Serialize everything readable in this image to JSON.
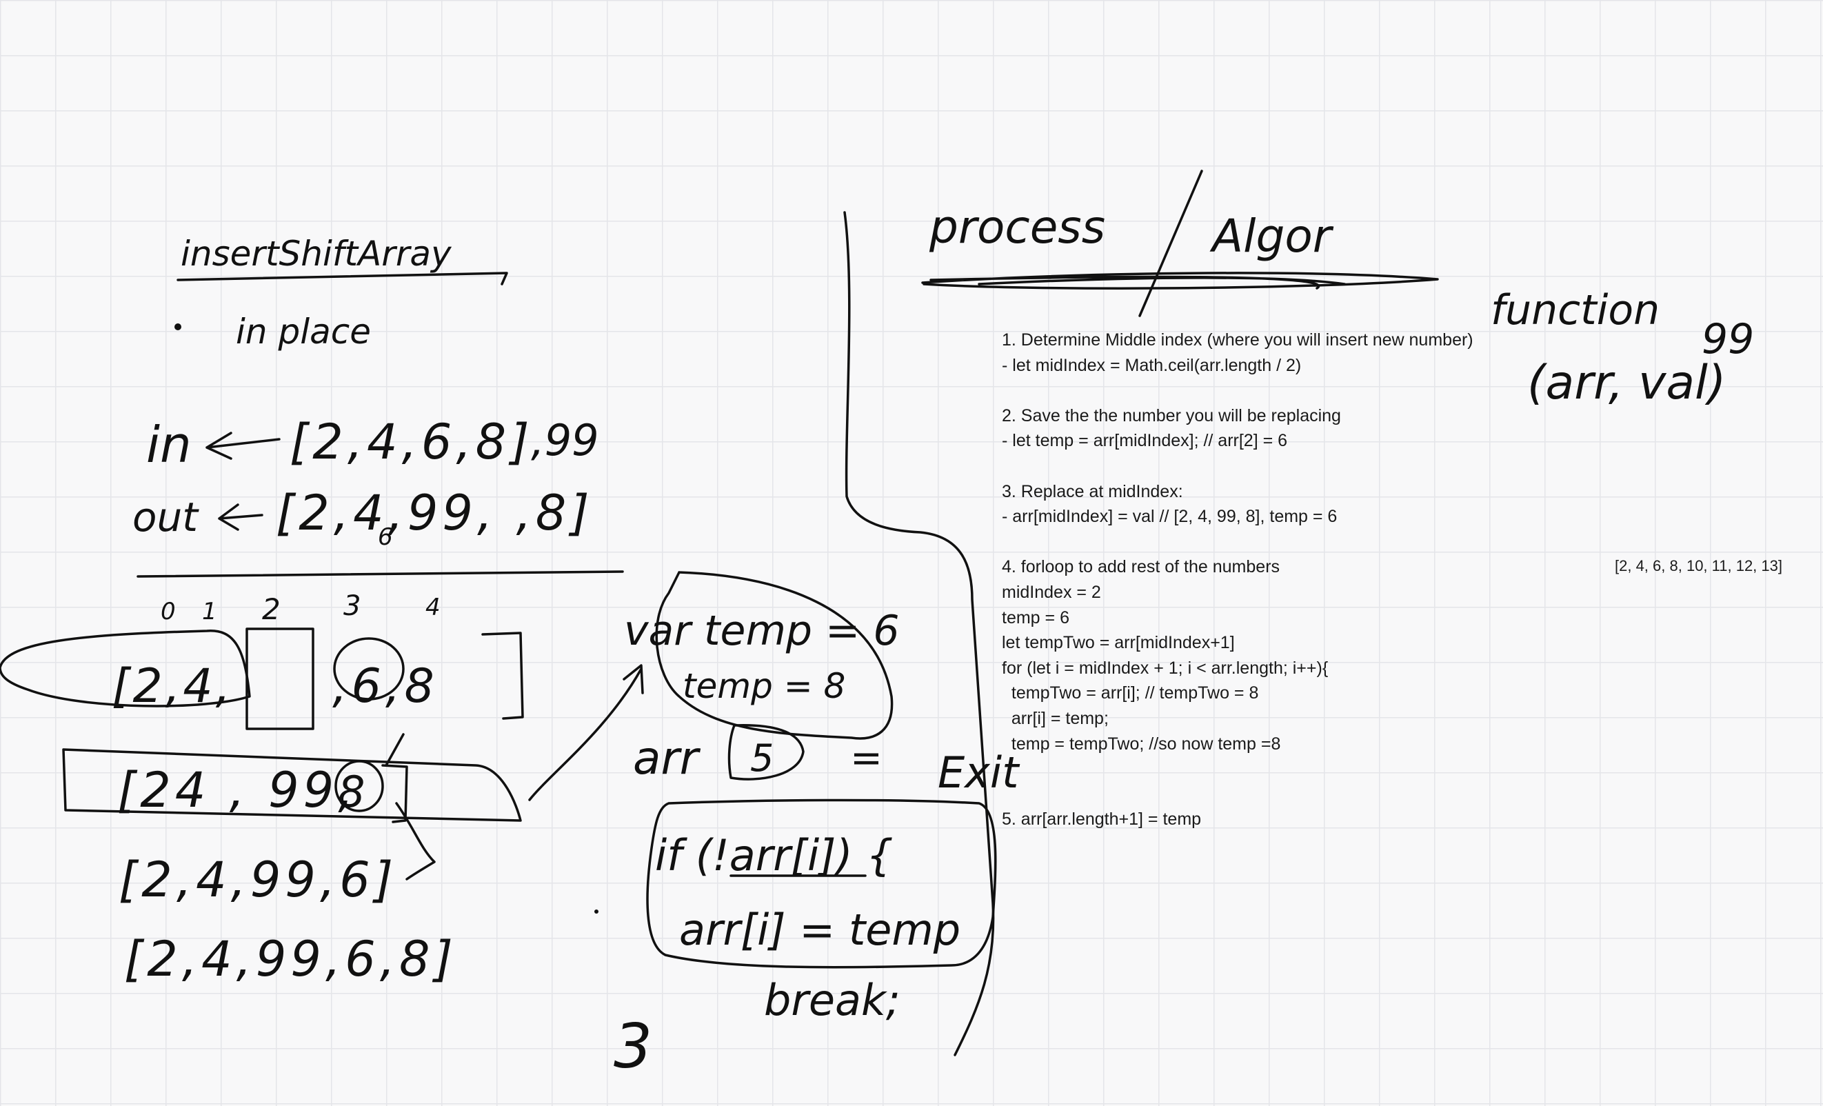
{
  "canvas": {
    "background": "#f8f8f9",
    "grid_color": "#e4e5e9",
    "ink_color": "#111111"
  },
  "handwriting": {
    "title": "insertShiftArray",
    "bullet": "in place",
    "in_label": "in",
    "in_array": "[2,4,6,8]",
    "in_val": ",99",
    "out_label": "out",
    "out_array": "[2,4,99, ,8]",
    "out_extra": "6",
    "indices": [
      "0",
      "1",
      "2",
      "3",
      "4"
    ],
    "row1_a": "[2,4,",
    "row1_b": ",6,8",
    "row1_circled": "6",
    "row2": "[24 , 99,",
    "row2_circled": "8",
    "row3": "[2,4,99,6]",
    "row4": "[2,4,99,6,8]",
    "var_temp": "var temp = 6",
    "temp8": "temp = 8",
    "arr_label": "arr",
    "arr_circled": "5",
    "equals": "=",
    "exit": "Exit",
    "if_line": "if (!arr[i]) {",
    "assign_line": "arr[i] = temp",
    "break_line": "break;",
    "brace_close": "3",
    "process_heading": "process",
    "algo_heading": "Algor",
    "function_word": "function",
    "function_99": "99",
    "function_args": "(arr, val)"
  },
  "algorithm_lines": [
    "1. Determine Middle index (where you will insert new number)",
    "- let midIndex = Math.ceil(arr.length / 2)",
    "",
    "2. Save the the number you will be replacing",
    "- let temp = arr[midIndex]; // arr[2] = 6",
    "",
    "3. Replace at midIndex:",
    "- arr[midIndex] = val // [2, 4, 99, 8], temp = 6",
    "",
    "4. forloop to add rest of the numbers",
    "midIndex = 2",
    "temp = 6",
    "let tempTwo = arr[midIndex+1]",
    "for (let i = midIndex + 1; i < arr.length; i++){",
    "  tempTwo = arr[i]; // tempTwo = 8",
    "  arr[i] = temp;",
    "  temp = tempTwo; //so now temp =8",
    "",
    "",
    "5. arr[arr.length+1] = temp"
  ],
  "side_array": "[2, 4, 6, 8, 10, 11, 12, 13]"
}
